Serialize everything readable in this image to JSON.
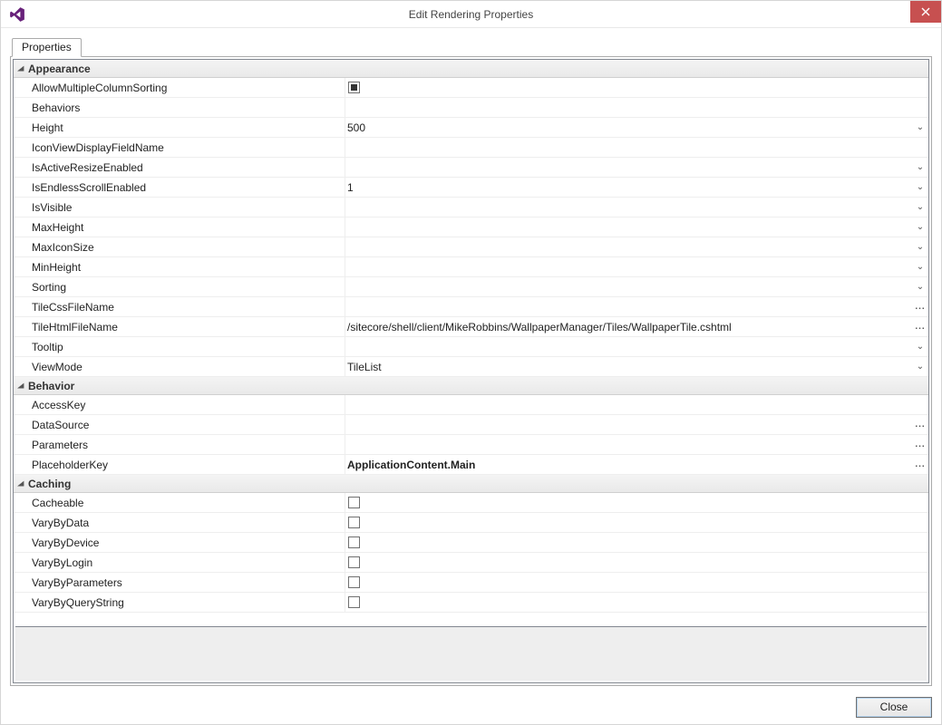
{
  "window": {
    "title": "Edit Rendering Properties",
    "close_icon": "✕"
  },
  "tabs": {
    "properties": "Properties"
  },
  "categories": [
    {
      "name": "Appearance",
      "rows": [
        {
          "key": "allow_multiple_column_sorting",
          "label": "AllowMultipleColumnSorting",
          "type": "checkbox_filled"
        },
        {
          "key": "behaviors",
          "label": "Behaviors",
          "value": ""
        },
        {
          "key": "height",
          "label": "Height",
          "value": "500",
          "btn": "dropdown"
        },
        {
          "key": "icon_view_display_field_name",
          "label": "IconViewDisplayFieldName",
          "value": ""
        },
        {
          "key": "is_active_resize_enabled",
          "label": "IsActiveResizeEnabled",
          "value": "",
          "btn": "dropdown"
        },
        {
          "key": "is_endless_scroll_enabled",
          "label": "IsEndlessScrollEnabled",
          "value": "1",
          "btn": "dropdown"
        },
        {
          "key": "is_visible",
          "label": "IsVisible",
          "value": "",
          "btn": "dropdown"
        },
        {
          "key": "max_height",
          "label": "MaxHeight",
          "value": "",
          "btn": "dropdown"
        },
        {
          "key": "max_icon_size",
          "label": "MaxIconSize",
          "value": "",
          "btn": "dropdown"
        },
        {
          "key": "min_height",
          "label": "MinHeight",
          "value": "",
          "btn": "dropdown"
        },
        {
          "key": "sorting",
          "label": "Sorting",
          "value": "",
          "btn": "dropdown"
        },
        {
          "key": "tile_css_file_name",
          "label": "TileCssFileName",
          "value": "",
          "btn": "ellipsis"
        },
        {
          "key": "tile_html_file_name",
          "label": "TileHtmlFileName",
          "value": "/sitecore/shell/client/MikeRobbins/WallpaperManager/Tiles/WallpaperTile.cshtml",
          "btn": "ellipsis"
        },
        {
          "key": "tooltip",
          "label": "Tooltip",
          "value": "",
          "btn": "dropdown"
        },
        {
          "key": "view_mode",
          "label": "ViewMode",
          "value": "TileList",
          "btn": "dropdown"
        }
      ]
    },
    {
      "name": "Behavior",
      "rows": [
        {
          "key": "access_key",
          "label": "AccessKey",
          "value": ""
        },
        {
          "key": "data_source",
          "label": "DataSource",
          "value": "",
          "btn": "ellipsis"
        },
        {
          "key": "parameters",
          "label": "Parameters",
          "value": "",
          "btn": "ellipsis"
        },
        {
          "key": "placeholder_key",
          "label": "PlaceholderKey",
          "value": "ApplicationContent.Main",
          "bold": true,
          "btn": "ellipsis"
        }
      ]
    },
    {
      "name": "Caching",
      "rows": [
        {
          "key": "cacheable",
          "label": "Cacheable",
          "type": "checkbox"
        },
        {
          "key": "vary_by_data",
          "label": "VaryByData",
          "type": "checkbox"
        },
        {
          "key": "vary_by_device",
          "label": "VaryByDevice",
          "type": "checkbox"
        },
        {
          "key": "vary_by_login",
          "label": "VaryByLogin",
          "type": "checkbox"
        },
        {
          "key": "vary_by_parameters",
          "label": "VaryByParameters",
          "type": "checkbox"
        },
        {
          "key": "vary_by_query_string",
          "label": "VaryByQueryString",
          "type": "checkbox"
        }
      ]
    }
  ],
  "footer": {
    "close": "Close"
  },
  "glyphs": {
    "dropdown": "⌄",
    "ellipsis": "...",
    "expander": "◢"
  }
}
